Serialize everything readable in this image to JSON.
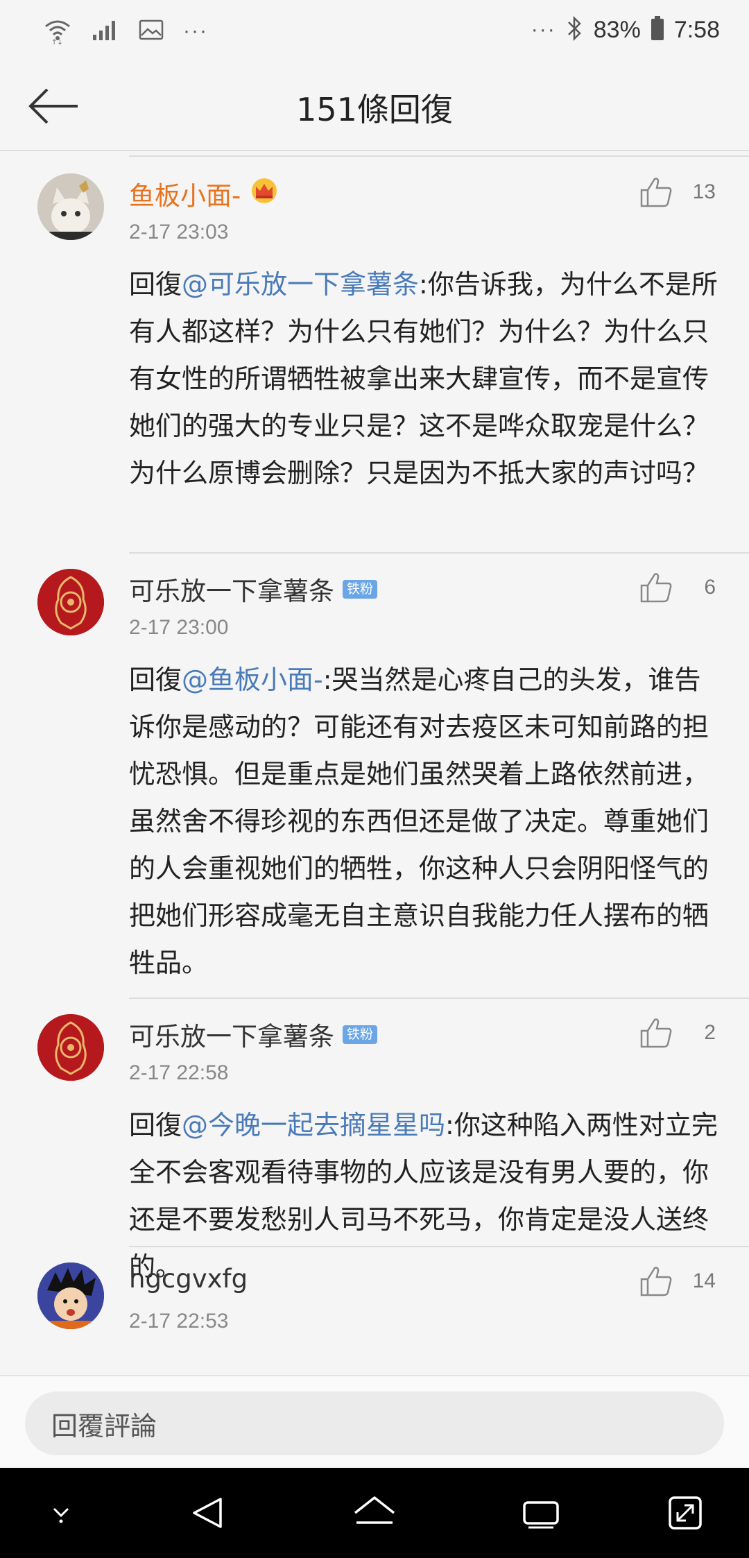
{
  "status_bar": {
    "dots_left": "···",
    "dots_right": "···",
    "battery": "83%",
    "time": "7:58"
  },
  "header": {
    "title": "151條回復"
  },
  "comments": [
    {
      "author": "鱼板小面-",
      "time": "2-17 23:03",
      "likes": "13",
      "reply_prefix": "回復",
      "mention": "@可乐放一下拿薯条",
      "text": ":你告诉我，为什么不是所有人都这样？为什么只有她们？为什么？为什么只有女性的所谓牺牲被拿出来大肆宣传，而不是宣传她们的强大的专业只是？这不是哗众取宠是什么？为什么原博会删除？只是因为不抵大家的声讨吗？"
    },
    {
      "author": "可乐放一下拿薯条",
      "badge": "铁粉",
      "time": "2-17 23:00",
      "likes": "6",
      "reply_prefix": "回復",
      "mention": "@鱼板小面-",
      "text": ":哭当然是心疼自己的头发，谁告诉你是感动的？可能还有对去疫区未可知前路的担忧恐惧。但是重点是她们虽然哭着上路依然前进，虽然舍不得珍视的东西但还是做了决定。尊重她们的人会重视她们的牺牲，你这种人只会阴阳怪气的把她们形容成毫无自主意识自我能力任人摆布的牺牲品。"
    },
    {
      "author": "可乐放一下拿薯条",
      "badge": "铁粉",
      "time": "2-17 22:58",
      "likes": "2",
      "reply_prefix": "回復",
      "mention": "@今晚一起去摘星星吗",
      "text": ":你这种陷入两性对立完全不会客观看待事物的人应该是没有男人要的，你还是不要发愁别人司马不死马，你肯定是没人送终的。"
    },
    {
      "author": "hgcgvxfg",
      "time": "2-17 22:53",
      "likes": "14"
    }
  ],
  "reply_bar": {
    "placeholder": "回覆評論"
  },
  "colors": {
    "vip_name": "#e8731f",
    "mention": "#4a7bb8",
    "badge": "#6aa6e6"
  }
}
